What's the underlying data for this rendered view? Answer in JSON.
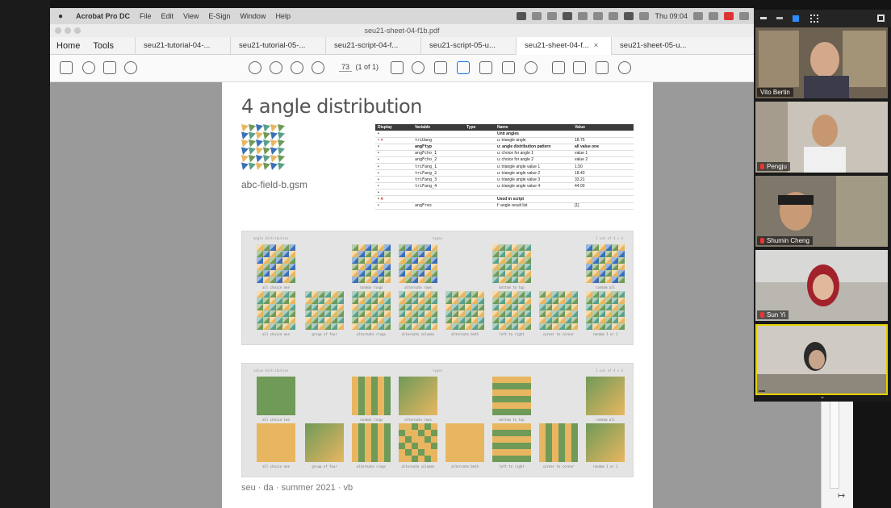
{
  "menubar": {
    "app_name": "Acrobat Pro DC",
    "items": [
      "File",
      "Edit",
      "View",
      "E-Sign",
      "Window",
      "Help"
    ],
    "clock": "Thu 09:04"
  },
  "window": {
    "title": "seu21-sheet-04-f1b.pdf"
  },
  "tabs": {
    "home": "Home",
    "tools": "Tools",
    "items": [
      {
        "label": "seu21-tutorial-04-...",
        "active": false
      },
      {
        "label": "seu21-tutorial-05-...",
        "active": false
      },
      {
        "label": "seu21-script-04-f...",
        "active": false
      },
      {
        "label": "seu21-script-05-u...",
        "active": false
      },
      {
        "label": "seu21-sheet-04-f...",
        "active": true
      },
      {
        "label": "seu21-sheet-05-u...",
        "active": false
      }
    ],
    "close_glyph": "×"
  },
  "toolbar": {
    "page_number": "73",
    "page_of": "(1 of 1)"
  },
  "document": {
    "title": "4 angle distribution",
    "filename": "abc-field-b.gsm",
    "footer": "seu · da · summer 2021 · vb",
    "table": {
      "headers": [
        "Display",
        "Variable",
        "Type",
        "Name",
        "Value"
      ],
      "rows": [
        {
          "display": "",
          "variable": "",
          "type": "",
          "name": "Unit angles",
          "value": "",
          "bold": true,
          "x": false
        },
        {
          "display": "",
          "variable": "triUang",
          "type": "",
          "name": "u: triangle angle",
          "value": "18.75",
          "bold": false,
          "x": true
        },
        {
          "display": "",
          "variable": "angFtyp",
          "type": "",
          "name": "u: angle distribution pattern",
          "value": "all value one",
          "bold": true,
          "x": false
        },
        {
          "display": "",
          "variable": "angFcho_1",
          "type": "",
          "name": "u: choice for angle 1",
          "value": "value 1",
          "bold": false,
          "x": false
        },
        {
          "display": "",
          "variable": "angFcho_2",
          "type": "",
          "name": "u: choice for angle 2",
          "value": "value 2",
          "bold": false,
          "x": false
        },
        {
          "display": "",
          "variable": "triFang_1",
          "type": "",
          "name": "u: triangle angle value 1",
          "value": "1.50",
          "bold": false,
          "x": false
        },
        {
          "display": "",
          "variable": "triFang_2",
          "type": "",
          "name": "u: triangle angle value 2",
          "value": "18.43",
          "bold": false,
          "x": false
        },
        {
          "display": "",
          "variable": "triFang_3",
          "type": "",
          "name": "u: triangle angle value 3",
          "value": "33.21",
          "bold": false,
          "x": false
        },
        {
          "display": "",
          "variable": "triFang_4",
          "type": "",
          "name": "u: triangle angle value 4",
          "value": "44.00",
          "bold": false,
          "x": false
        },
        {
          "display": "",
          "variable": "",
          "type": "",
          "name": "",
          "value": "",
          "bold": false,
          "x": false
        },
        {
          "display": "",
          "variable": "",
          "type": "",
          "name": "Used in script",
          "value": "",
          "bold": true,
          "x": true
        },
        {
          "display": "",
          "variable": "angFres",
          "type": "",
          "name": "f: angle result list",
          "value": "[1]",
          "bold": false,
          "x": false
        }
      ]
    },
    "panel1": {
      "title": "angle distribution",
      "center": "types",
      "right": "1 out of 4 x 4",
      "row1": [
        "all choice one",
        "",
        "random rings",
        "alternate rows",
        "",
        "bottom to top",
        "",
        "random all"
      ],
      "row2": [
        "all choice one",
        "group of four",
        "alternate rings",
        "alternate columns",
        "alternate both",
        "left to right",
        "corner to corner",
        "random 1 or 2"
      ]
    },
    "panel2": {
      "title": "value distribution",
      "center": "types",
      "right": "1 out of 4 x 4",
      "row1": [
        "all choice two",
        "",
        "random rings",
        "alternate rows",
        "",
        "bottom to top",
        "",
        "random all"
      ],
      "row2": [
        "all choice one",
        "group of four",
        "alternate rings",
        "alternate columns",
        "alternate both",
        "left to right",
        "corner to corner",
        "random 1 or 2"
      ]
    }
  },
  "participants": [
    {
      "name": "Vito Bertin",
      "active": false
    },
    {
      "name": "Pengju",
      "active": false
    },
    {
      "name": "Shumin Cheng",
      "active": false
    },
    {
      "name": "Sun Yi",
      "active": false
    },
    {
      "name": "",
      "active": true
    }
  ],
  "colors": {
    "orange": "#e8b660",
    "green": "#6f9a58",
    "blue": "#3b6fb8",
    "teal": "#5aa08a",
    "zoom_active": "#e6d200"
  }
}
